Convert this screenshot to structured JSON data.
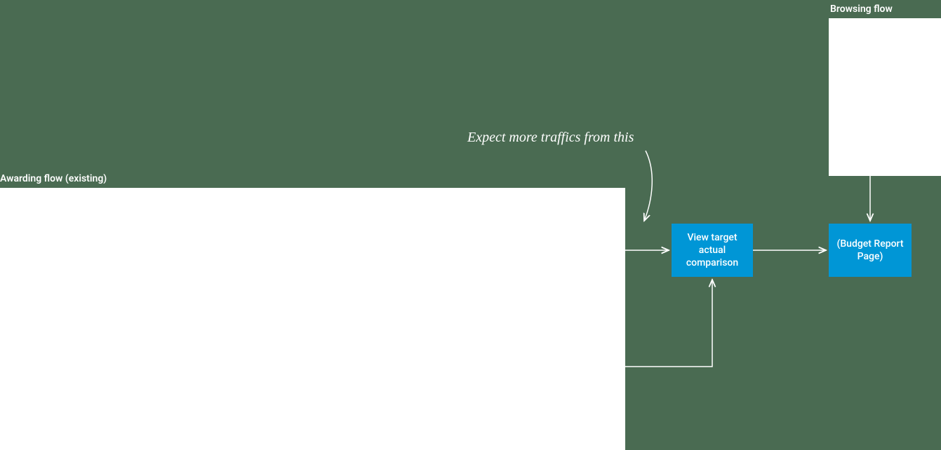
{
  "labels": {
    "awarding": "Awarding flow (existing)",
    "browsing": "Browsing flow"
  },
  "nodes": {
    "view_target": "View target actual comparison",
    "budget_report": "(Budget Report Page)"
  },
  "annotation": "Expect more traffics from this",
  "colors": {
    "bg": "#4a6b52",
    "node": "#0096d6",
    "text": "#ffffff"
  }
}
